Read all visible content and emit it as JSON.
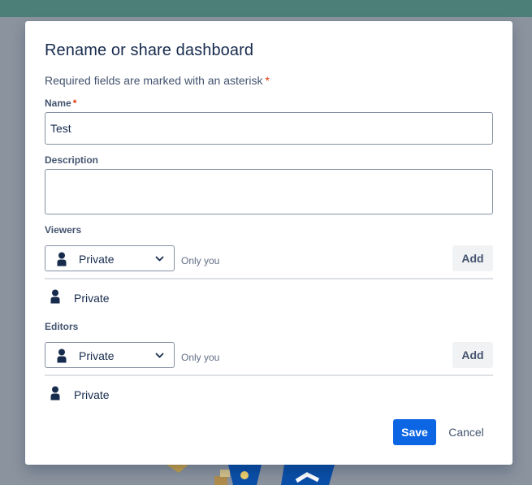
{
  "dialog": {
    "title": "Rename or share dashboard",
    "required_note": "Required fields are marked with an asterisk",
    "required_marker": "*"
  },
  "fields": {
    "name": {
      "label": "Name",
      "required_marker": "*",
      "value": "Test"
    },
    "description": {
      "label": "Description",
      "value": ""
    }
  },
  "viewers": {
    "label": "Viewers",
    "select_value": "Private",
    "hint": "Only you",
    "add_label": "Add",
    "items": [
      {
        "icon": "person-icon",
        "label": "Private"
      }
    ]
  },
  "editors": {
    "label": "Editors",
    "select_value": "Private",
    "hint": "Only you",
    "add_label": "Add",
    "items": [
      {
        "icon": "person-icon",
        "label": "Private"
      }
    ]
  },
  "actions": {
    "save_label": "Save",
    "cancel_label": "Cancel"
  },
  "colors": {
    "primary": "#0c66e4",
    "text": "#172b4d",
    "subtle_text": "#44546f",
    "required": "#de350b",
    "header_bar": "#4d7f79",
    "overlay": "#8b939e"
  }
}
